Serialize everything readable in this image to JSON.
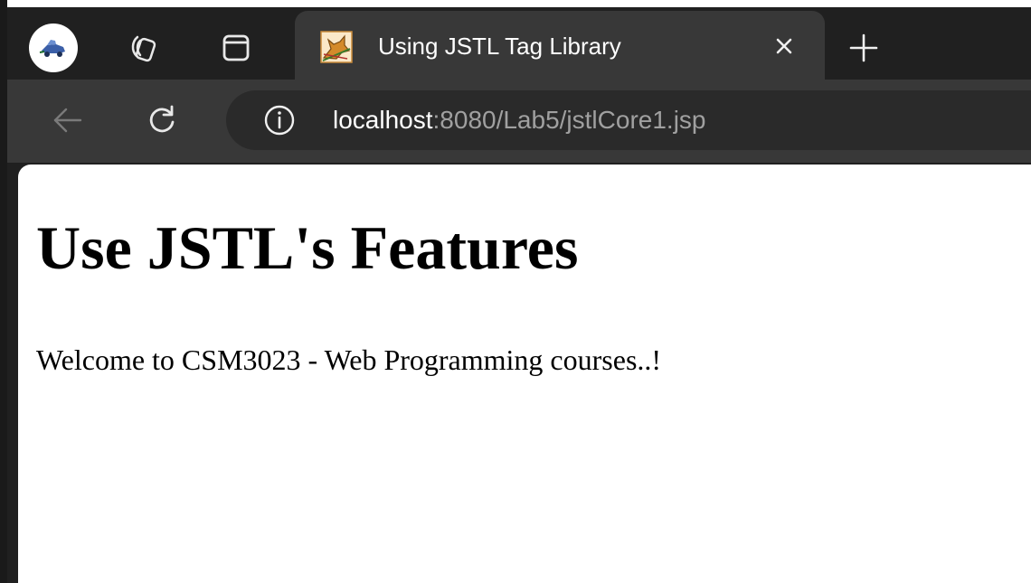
{
  "colors": {
    "tabstrip_bg": "#202020",
    "toolbar_bg": "#383838",
    "omnibox_bg": "#2a2a2a",
    "url_host": "#ffffff",
    "url_path": "#a0a0a0",
    "page_bg": "#ffffff"
  },
  "tabstrip": {
    "profile_icon": "profile-avatar-icon",
    "workspaces_icon": "workspaces-icon",
    "tab_actions_icon": "tab-actions-icon",
    "active_tab": {
      "favicon": "tomcat-favicon-icon",
      "title": "Using JSTL Tag Library",
      "close_icon": "close-icon"
    },
    "new_tab_icon": "plus-icon"
  },
  "toolbar": {
    "back_icon": "back-arrow-icon",
    "reload_icon": "reload-icon",
    "site_info_icon": "info-icon",
    "url_host": "localhost",
    "url_path": ":8080/Lab5/jstlCore1.jsp"
  },
  "page": {
    "heading": "Use JSTL's Features",
    "message": "Welcome to CSM3023 - Web Programming courses..!"
  }
}
